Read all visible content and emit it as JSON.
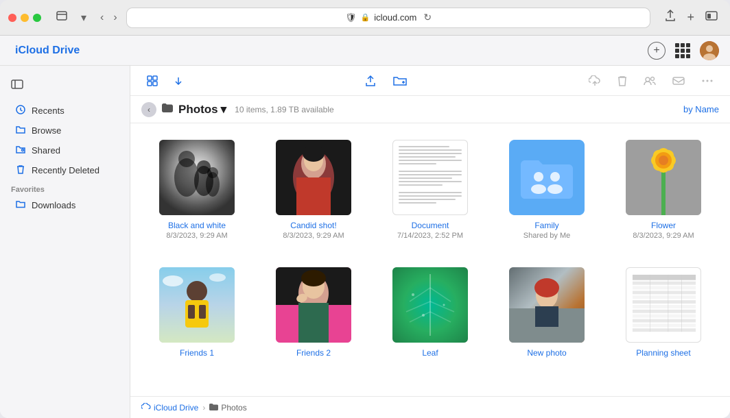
{
  "browser": {
    "url": "icloud.com",
    "reload_label": "↻"
  },
  "app": {
    "title": "iCloud Drive",
    "apple_symbol": ""
  },
  "sidebar": {
    "toggle_icon": "sidebar",
    "items": [
      {
        "id": "recents",
        "label": "Recents",
        "icon": "🕐"
      },
      {
        "id": "browse",
        "label": "Browse",
        "icon": "📁"
      },
      {
        "id": "shared",
        "label": "Shared",
        "icon": "🔗"
      },
      {
        "id": "recently-deleted",
        "label": "Recently Deleted",
        "icon": "🗑"
      }
    ],
    "favorites_label": "Favorites",
    "favorites_items": [
      {
        "id": "downloads",
        "label": "Downloads",
        "icon": "📁"
      }
    ]
  },
  "toolbar": {
    "view_grid_icon": "grid",
    "upload_icon": "upload",
    "new_folder_icon": "folder-plus",
    "cloud_upload_icon": "cloud-upload",
    "trash_icon": "trash",
    "share_icon": "share-people",
    "email_icon": "email",
    "more_icon": "ellipsis"
  },
  "path": {
    "back_icon": "chevron-left",
    "folder_icon": "folder",
    "title": "Photos",
    "chevron": "▾",
    "subtitle": "10 items, 1.89 TB available",
    "sort_label": "by Name"
  },
  "files": [
    {
      "id": "black-and-white",
      "name": "Black and white",
      "type": "photo-bw",
      "date": "8/3/2023, 9:29 AM",
      "subtext": ""
    },
    {
      "id": "candid-shot",
      "name": "Candid shot!",
      "type": "photo-candid",
      "date": "8/3/2023, 9:29 AM",
      "subtext": ""
    },
    {
      "id": "document",
      "name": "Document",
      "type": "doc",
      "date": "7/14/2023, 2:52 PM",
      "subtext": ""
    },
    {
      "id": "family",
      "name": "Family",
      "type": "folder-shared",
      "date": "",
      "subtext": "Shared by Me"
    },
    {
      "id": "flower",
      "name": "Flower",
      "type": "photo-flower",
      "date": "8/3/2023, 9:29 AM",
      "subtext": ""
    },
    {
      "id": "friends1",
      "name": "Friends 1",
      "type": "photo-friends1",
      "date": "",
      "subtext": ""
    },
    {
      "id": "friends2",
      "name": "Friends 2",
      "type": "photo-friends2",
      "date": "",
      "subtext": ""
    },
    {
      "id": "leaf",
      "name": "Leaf",
      "type": "photo-leaf",
      "date": "",
      "subtext": ""
    },
    {
      "id": "new-photo",
      "name": "New photo",
      "type": "photo-newphoto",
      "date": "",
      "subtext": ""
    },
    {
      "id": "planning-sheet",
      "name": "Planning sheet",
      "type": "planning",
      "date": "",
      "subtext": ""
    }
  ],
  "breadcrumb": {
    "root_label": "iCloud Drive",
    "root_icon": "cloud",
    "sep": "›",
    "current_label": "Photos",
    "current_icon": "folder"
  }
}
